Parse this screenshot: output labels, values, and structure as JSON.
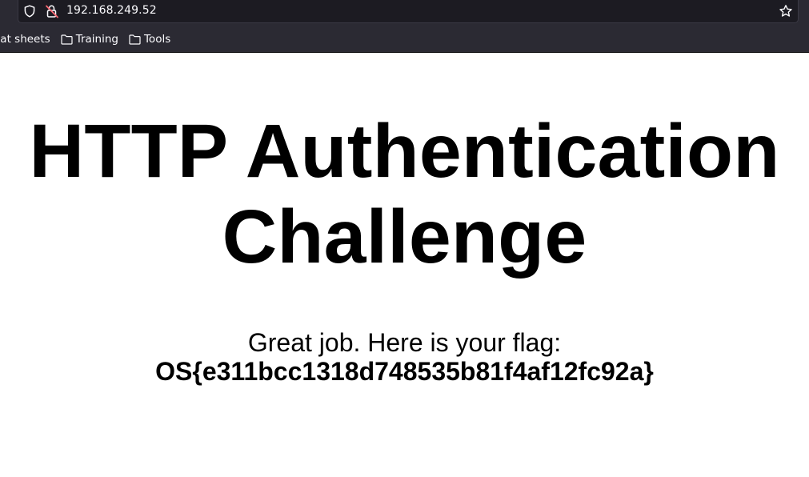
{
  "browser": {
    "url": "192.168.249.52",
    "bookmarks": [
      {
        "label": "eat sheets",
        "icon": "folder-icon"
      },
      {
        "label": "Training",
        "icon": "folder-icon"
      },
      {
        "label": "Tools",
        "icon": "folder-icon"
      }
    ],
    "icons": {
      "tracking": "shield-icon",
      "security": "insecure-lock-icon",
      "bookmark": "star-icon"
    }
  },
  "page": {
    "title": "HTTP Authentication Challenge",
    "message": "Great job. Here is your flag:",
    "flag": "OS{e311bcc1318d748535b81f4af12fc92a}"
  }
}
